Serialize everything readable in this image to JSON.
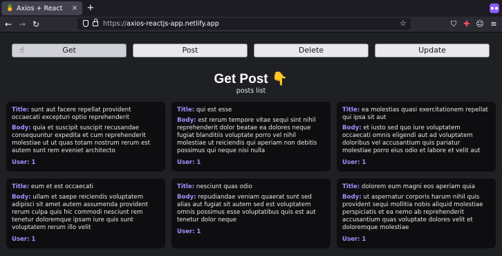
{
  "browser": {
    "tab_title": "Axios + React",
    "tab_favicon": "🍍",
    "url_prefix": "https://",
    "url_host": "axios-reactjs-app.netlify.app"
  },
  "page": {
    "buttons": [
      "Get",
      "Post",
      "Delete",
      "Update"
    ],
    "heading": "Get Post 👇",
    "subheading": "posts list",
    "labels": {
      "title": "Title:",
      "body": "Body:",
      "user": "User:"
    },
    "posts": [
      {
        "title": "sunt aut facere repellat provident occaecati excepturi optio reprehenderit",
        "body": "quia et suscipit suscipit recusandae consequuntur expedita et cum reprehenderit molestiae ut ut quas totam nostrum rerum est autem sunt rem eveniet architecto",
        "user": "1"
      },
      {
        "title": "qui est esse",
        "body": "est rerum tempore vitae sequi sint nihil reprehenderit dolor beatae ea dolores neque fugiat blanditiis voluptate porro vel nihil molestiae ut reiciendis qui aperiam non debitis possimus qui neque nisi nulla",
        "user": "1"
      },
      {
        "title": "ea molestias quasi exercitationem repellat qui ipsa sit aut",
        "body": "et iusto sed quo iure voluptatem occaecati omnis eligendi aut ad voluptatem doloribus vel accusantium quis pariatur molestiae porro eius odio et labore et velit aut",
        "user": "1"
      },
      {
        "title": "eum et est occaecati",
        "body": "ullam et saepe reiciendis voluptatem adipisci sit amet autem assumenda provident rerum culpa quis hic commodi nesciunt rem tenetur doloremque ipsam iure quis sunt voluptatem rerum illo velit",
        "user": "1"
      },
      {
        "title": "nesciunt quas odio",
        "body": "repudiandae veniam quaerat sunt sed alias aut fugiat sit autem sed est voluptatem omnis possimus esse voluptatibus quis est aut tenetur dolor neque",
        "user": "1"
      },
      {
        "title": "dolorem eum magni eos aperiam quia",
        "body": "ut aspernatur corporis harum nihil quis provident sequi mollitia nobis aliquid molestiae perspiciatis et ea nemo ab reprehenderit accusantium quas voluptate dolores velit et doloremque molestiae",
        "user": "1"
      }
    ]
  }
}
